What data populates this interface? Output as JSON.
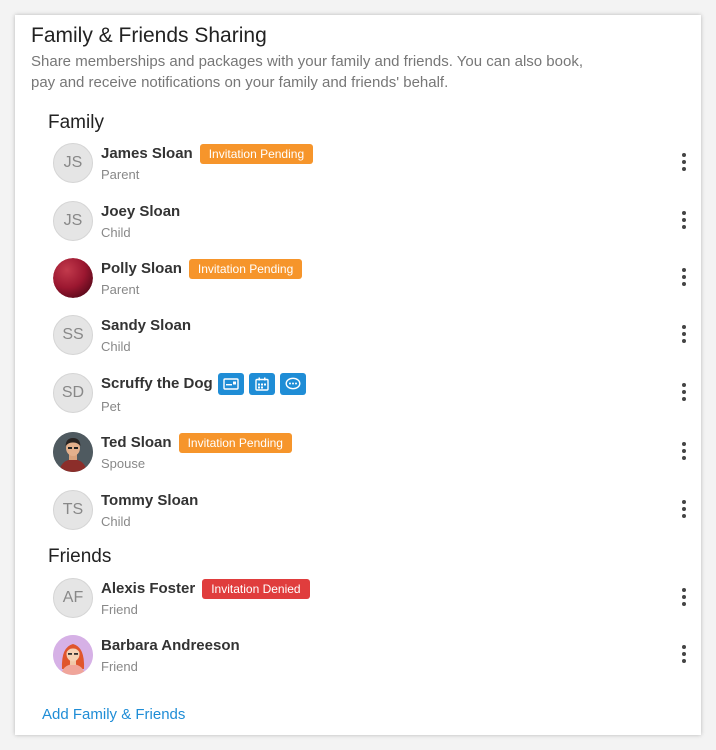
{
  "header": {
    "title": "Family & Friends Sharing",
    "description": "Share memberships and packages with your family and friends. You can also book, pay and receive notifications on your family and friends' behalf."
  },
  "family": {
    "heading": "Family",
    "members": [
      {
        "initials": "JS",
        "name": "James Sloan",
        "role": "Parent",
        "badge": "Invitation Pending"
      },
      {
        "initials": "JS",
        "name": "Joey Sloan",
        "role": "Child"
      },
      {
        "name": "Polly Sloan",
        "role": "Parent",
        "badge": "Invitation Pending"
      },
      {
        "initials": "SS",
        "name": "Sandy Sloan",
        "role": "Child"
      },
      {
        "initials": "SD",
        "name": "Scruffy the Dog",
        "role": "Pet"
      },
      {
        "name": "Ted Sloan",
        "role": "Spouse",
        "badge": "Invitation Pending"
      },
      {
        "initials": "TS",
        "name": "Tommy Sloan",
        "role": "Child"
      }
    ]
  },
  "friends": {
    "heading": "Friends",
    "members": [
      {
        "initials": "AF",
        "name": "Alexis Foster",
        "role": "Friend",
        "badge": "Invitation Denied"
      },
      {
        "name": "Barbara Andreeson",
        "role": "Friend"
      }
    ]
  },
  "footer": {
    "add_link": "Add Family & Friends"
  },
  "colors": {
    "accent": "#1f8dd6",
    "pending": "#f6952b",
    "denied": "#e03d3d"
  }
}
